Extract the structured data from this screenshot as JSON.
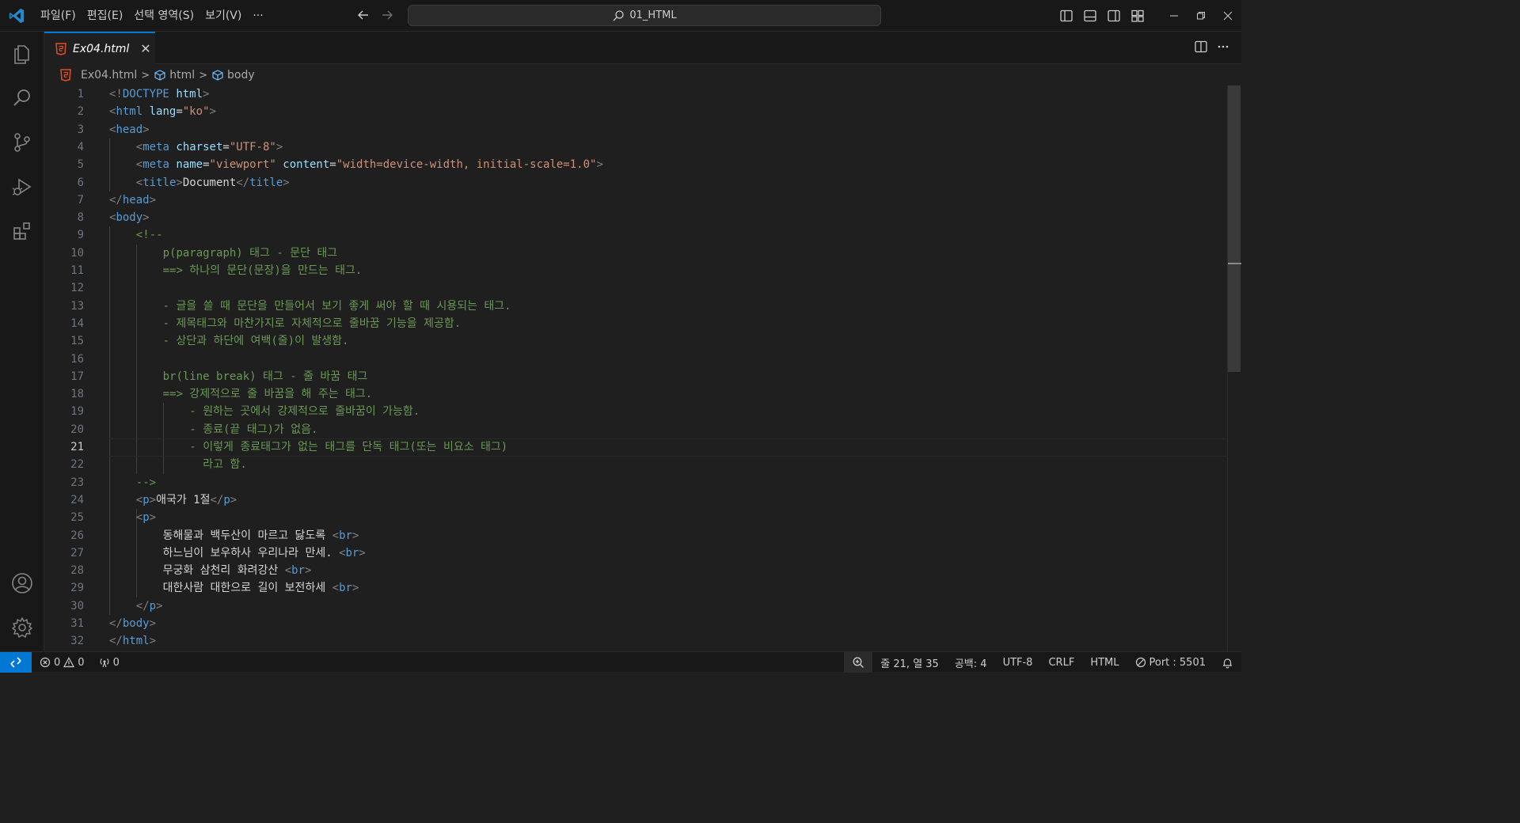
{
  "titlebar": {
    "menu": [
      "파일(F)",
      "편집(E)",
      "선택 영역(S)",
      "보기(V)",
      "···"
    ],
    "search_text": "01_HTML"
  },
  "tab": {
    "filename": "Ex04.html",
    "close": "✕"
  },
  "breadcrumb": {
    "file": "Ex04.html",
    "html": "html",
    "body": "body"
  },
  "editor": {
    "current_line": 21,
    "lines": [
      {
        "n": "1",
        "indent": 0,
        "tokens": [
          [
            "bracket",
            "<!"
          ],
          [
            "tag",
            "DOCTYPE"
          ],
          [
            "text",
            " "
          ],
          [
            "attr",
            "html"
          ],
          [
            "bracket",
            ">"
          ]
        ]
      },
      {
        "n": "2",
        "indent": 0,
        "tokens": [
          [
            "bracket",
            "<"
          ],
          [
            "tag",
            "html"
          ],
          [
            "text",
            " "
          ],
          [
            "attr",
            "lang"
          ],
          [
            "text",
            "="
          ],
          [
            "str",
            "\"ko\""
          ],
          [
            "bracket",
            ">"
          ]
        ]
      },
      {
        "n": "3",
        "indent": 0,
        "tokens": [
          [
            "bracket",
            "<"
          ],
          [
            "tag",
            "head"
          ],
          [
            "bracket",
            ">"
          ]
        ]
      },
      {
        "n": "4",
        "indent": 1,
        "tokens": [
          [
            "bracket",
            "<"
          ],
          [
            "tag",
            "meta"
          ],
          [
            "text",
            " "
          ],
          [
            "attr",
            "charset"
          ],
          [
            "text",
            "="
          ],
          [
            "str",
            "\"UTF-8\""
          ],
          [
            "bracket",
            ">"
          ]
        ]
      },
      {
        "n": "5",
        "indent": 1,
        "tokens": [
          [
            "bracket",
            "<"
          ],
          [
            "tag",
            "meta"
          ],
          [
            "text",
            " "
          ],
          [
            "attr",
            "name"
          ],
          [
            "text",
            "="
          ],
          [
            "str",
            "\"viewport\""
          ],
          [
            "text",
            " "
          ],
          [
            "attr",
            "content"
          ],
          [
            "text",
            "="
          ],
          [
            "str",
            "\"width=device-width, initial-scale=1.0\""
          ],
          [
            "bracket",
            ">"
          ]
        ]
      },
      {
        "n": "6",
        "indent": 1,
        "tokens": [
          [
            "bracket",
            "<"
          ],
          [
            "tag",
            "title"
          ],
          [
            "bracket",
            ">"
          ],
          [
            "text",
            "Document"
          ],
          [
            "bracket",
            "</"
          ],
          [
            "tag",
            "title"
          ],
          [
            "bracket",
            ">"
          ]
        ]
      },
      {
        "n": "7",
        "indent": 0,
        "tokens": [
          [
            "bracket",
            "</"
          ],
          [
            "tag",
            "head"
          ],
          [
            "bracket",
            ">"
          ]
        ]
      },
      {
        "n": "8",
        "indent": 0,
        "tokens": [
          [
            "bracket",
            "<"
          ],
          [
            "tag",
            "body"
          ],
          [
            "bracket",
            ">"
          ]
        ]
      },
      {
        "n": "9",
        "indent": 1,
        "tokens": [
          [
            "com",
            "<!--"
          ]
        ]
      },
      {
        "n": "10",
        "indent": 2,
        "tokens": [
          [
            "com",
            "p(paragraph) 태그 - 문단 태그"
          ]
        ]
      },
      {
        "n": "11",
        "indent": 2,
        "tokens": [
          [
            "com",
            "==> 하나의 문단(문장)을 만드는 태그."
          ]
        ]
      },
      {
        "n": "12",
        "indent": 0,
        "tokens": []
      },
      {
        "n": "13",
        "indent": 2,
        "tokens": [
          [
            "com",
            "- 글을 쓸 때 문단을 만들어서 보기 좋게 써야 할 때 시용되는 태그."
          ]
        ]
      },
      {
        "n": "14",
        "indent": 2,
        "tokens": [
          [
            "com",
            "- 제목태그와 마찬가지로 자체적으로 줄바꿈 기능을 제공함."
          ]
        ]
      },
      {
        "n": "15",
        "indent": 2,
        "tokens": [
          [
            "com",
            "- 상단과 하단에 여백(줄)이 발생함."
          ]
        ]
      },
      {
        "n": "16",
        "indent": 0,
        "tokens": []
      },
      {
        "n": "17",
        "indent": 2,
        "tokens": [
          [
            "com",
            "br(line break) 태그 - 줄 바꿈 태그"
          ]
        ]
      },
      {
        "n": "18",
        "indent": 2,
        "tokens": [
          [
            "com",
            "==> 강제적으로 줄 바꿈을 해 주는 태그."
          ]
        ]
      },
      {
        "n": "19",
        "indent": 3,
        "tokens": [
          [
            "com",
            "- 원하는 곳에서 강제적으로 줄바꿈이 가능함."
          ]
        ]
      },
      {
        "n": "20",
        "indent": 3,
        "tokens": [
          [
            "com",
            "- 종료(끝 태그)가 없음."
          ]
        ]
      },
      {
        "n": "21",
        "indent": 3,
        "tokens": [
          [
            "com",
            "- 이렇게 종료태그가 없는 태그를 단독 태그(또는 비요소 태그)"
          ]
        ]
      },
      {
        "n": "22",
        "indent": 3,
        "tokens": [
          [
            "com",
            "  라고 함."
          ]
        ]
      },
      {
        "n": "23",
        "indent": 1,
        "tokens": [
          [
            "com",
            "-->"
          ]
        ]
      },
      {
        "n": "24",
        "indent": 1,
        "tokens": [
          [
            "bracket",
            "<"
          ],
          [
            "tag",
            "p"
          ],
          [
            "bracket",
            ">"
          ],
          [
            "text",
            "애국가 1절"
          ],
          [
            "bracket",
            "</"
          ],
          [
            "tag",
            "p"
          ],
          [
            "bracket",
            ">"
          ]
        ]
      },
      {
        "n": "25",
        "indent": 1,
        "tokens": [
          [
            "bracket",
            "<"
          ],
          [
            "tag",
            "p"
          ],
          [
            "bracket",
            ">"
          ]
        ]
      },
      {
        "n": "26",
        "indent": 2,
        "tokens": [
          [
            "text",
            "동해물과 백두산이 마르고 닳도록 "
          ],
          [
            "bracket",
            "<"
          ],
          [
            "tag",
            "br"
          ],
          [
            "bracket",
            ">"
          ]
        ]
      },
      {
        "n": "27",
        "indent": 2,
        "tokens": [
          [
            "text",
            "하느님이 보우하사 우리나라 만세. "
          ],
          [
            "bracket",
            "<"
          ],
          [
            "tag",
            "br"
          ],
          [
            "bracket",
            ">"
          ]
        ]
      },
      {
        "n": "28",
        "indent": 2,
        "tokens": [
          [
            "text",
            "무궁화 삼천리 화려강산 "
          ],
          [
            "bracket",
            "<"
          ],
          [
            "tag",
            "br"
          ],
          [
            "bracket",
            ">"
          ]
        ]
      },
      {
        "n": "29",
        "indent": 2,
        "tokens": [
          [
            "text",
            "대한사람 대한으로 길이 보전하세 "
          ],
          [
            "bracket",
            "<"
          ],
          [
            "tag",
            "br"
          ],
          [
            "bracket",
            ">"
          ]
        ]
      },
      {
        "n": "30",
        "indent": 1,
        "tokens": [
          [
            "bracket",
            "</"
          ],
          [
            "tag",
            "p"
          ],
          [
            "bracket",
            ">"
          ]
        ]
      },
      {
        "n": "31",
        "indent": 0,
        "tokens": [
          [
            "bracket",
            "</"
          ],
          [
            "tag",
            "body"
          ],
          [
            "bracket",
            ">"
          ]
        ]
      },
      {
        "n": "32",
        "indent": 0,
        "tokens": [
          [
            "bracket",
            "</"
          ],
          [
            "tag",
            "html"
          ],
          [
            "bracket",
            ">"
          ]
        ]
      }
    ]
  },
  "statusbar": {
    "errors": "0",
    "warnings": "0",
    "ports": "0",
    "position": "줄 21, 열 35",
    "spaces": "공백: 4",
    "encoding": "UTF-8",
    "eol": "CRLF",
    "language": "HTML",
    "port": "Port : 5501"
  },
  "colors": {
    "accent": "#0078d4",
    "tag": "#569cd6",
    "attr": "#9cdcfe",
    "string": "#ce9178",
    "comment": "#6a9955",
    "html_icon": "#e44d26"
  }
}
